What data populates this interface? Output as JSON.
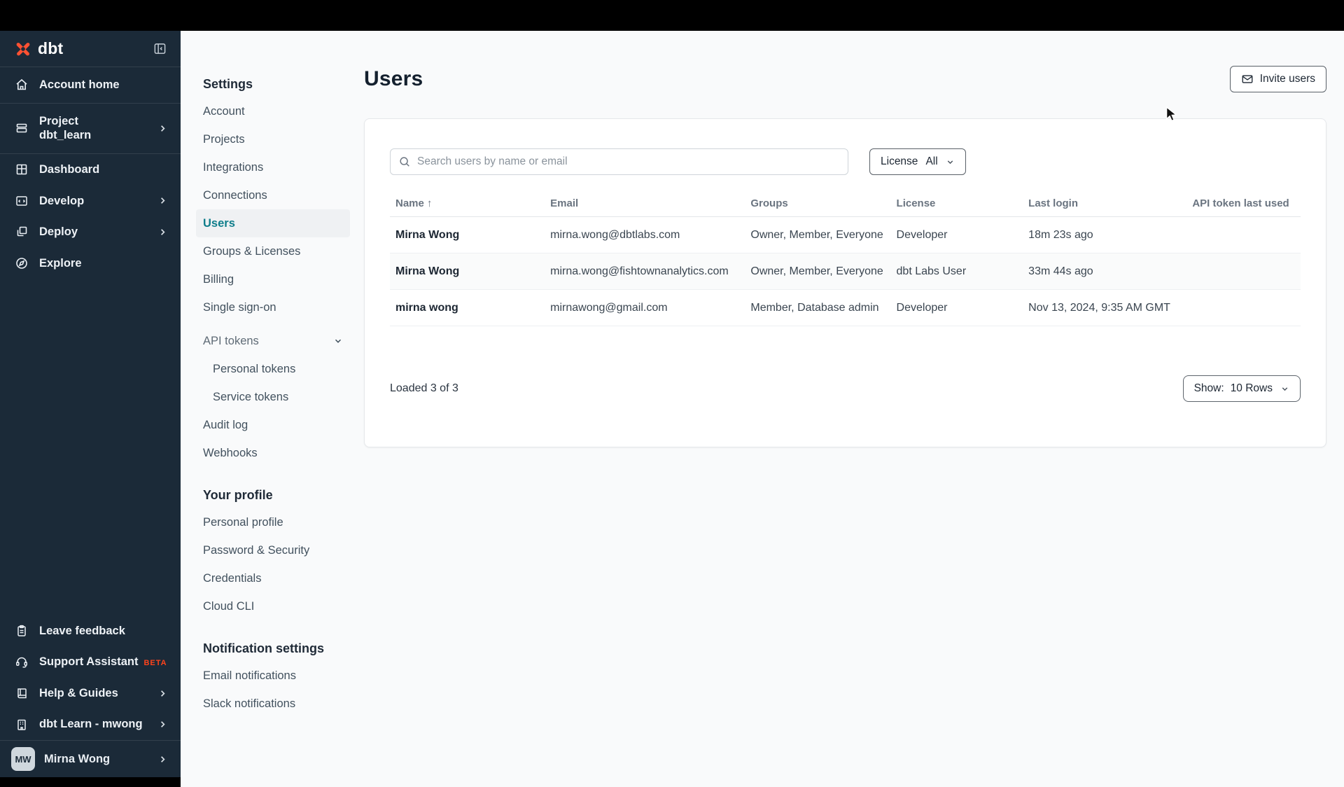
{
  "sidebar": {
    "logo_text": "dbt",
    "items": [
      {
        "label": "Account home"
      },
      {
        "label": "Project",
        "sublabel": "dbt_learn"
      },
      {
        "label": "Dashboard"
      },
      {
        "label": "Develop"
      },
      {
        "label": "Deploy"
      },
      {
        "label": "Explore"
      }
    ],
    "bottom_items": [
      {
        "label": "Leave feedback"
      },
      {
        "label": "Support Assistant",
        "badge": "BETA"
      },
      {
        "label": "Help & Guides"
      },
      {
        "label": "dbt Learn - mwong"
      }
    ],
    "user": {
      "initials": "MW",
      "name": "Mirna Wong"
    }
  },
  "settings_nav": {
    "sections": [
      {
        "heading": "Settings",
        "items": [
          {
            "label": "Account"
          },
          {
            "label": "Projects"
          },
          {
            "label": "Integrations"
          },
          {
            "label": "Connections"
          },
          {
            "label": "Users"
          },
          {
            "label": "Groups & Licenses"
          },
          {
            "label": "Billing"
          },
          {
            "label": "Single sign-on"
          },
          {
            "label": "API tokens"
          },
          {
            "label": "Personal tokens"
          },
          {
            "label": "Service tokens"
          },
          {
            "label": "Audit log"
          },
          {
            "label": "Webhooks"
          }
        ]
      },
      {
        "heading": "Your profile",
        "items": [
          {
            "label": "Personal profile"
          },
          {
            "label": "Password & Security"
          },
          {
            "label": "Credentials"
          },
          {
            "label": "Cloud CLI"
          }
        ]
      },
      {
        "heading": "Notification settings",
        "items": [
          {
            "label": "Email notifications"
          },
          {
            "label": "Slack notifications"
          }
        ]
      }
    ]
  },
  "main": {
    "title": "Users",
    "invite_button": "Invite users",
    "search_placeholder": "Search users by name or email",
    "license_filter": {
      "label": "License",
      "value": "All"
    },
    "table": {
      "columns": [
        "Name",
        "Email",
        "Groups",
        "License",
        "Last login",
        "API token last used"
      ],
      "sort_column": "Name",
      "sort_direction": "asc",
      "rows": [
        {
          "name": "Mirna Wong",
          "email": "mirna.wong@dbtlabs.com",
          "groups": "Owner, Member, Everyone",
          "license": "Developer",
          "last_login": "18m 23s ago",
          "api_token_last_used": ""
        },
        {
          "name": "Mirna Wong",
          "email": "mirna.wong@fishtownanalytics.com",
          "groups": "Owner, Member, Everyone",
          "license": "dbt Labs User",
          "last_login": "33m 44s ago",
          "api_token_last_used": ""
        },
        {
          "name": "mirna wong",
          "email": "mirnawong@gmail.com",
          "groups": "Member, Database admin",
          "license": "Developer",
          "last_login": "Nov 13, 2024, 9:35 AM GMT",
          "api_token_last_used": ""
        }
      ]
    },
    "loaded_text": "Loaded 3 of 3",
    "show_label": "Show:",
    "show_value": "10 Rows"
  },
  "colors": {
    "sidebar_bg": "#1b2a38",
    "accent_teal": "#0f7e8b",
    "logo_coral": "#ff5132",
    "beta_badge": "#ff431b"
  }
}
